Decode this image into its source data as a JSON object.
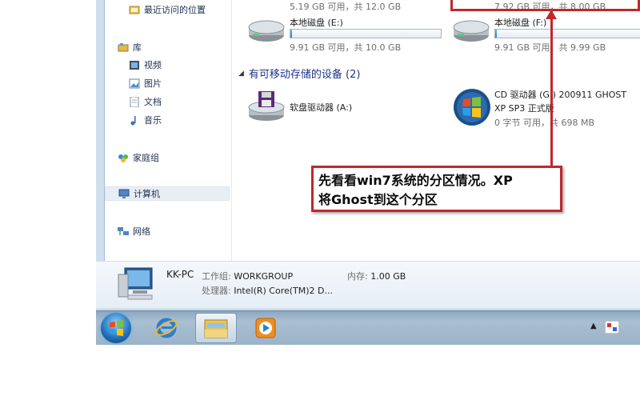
{
  "nav": {
    "recent": "最近访问的位置",
    "library": "库",
    "video": "视频",
    "pictures": "图片",
    "documents": "文档",
    "music": "音乐",
    "homegroup": "家庭组",
    "computer": "计算机",
    "network": "网络"
  },
  "drives": {
    "top_left_info": "5.19 GB 可用，共 12.0 GB",
    "top_right_info": "7.92 GB 可用，共 8.00 GB",
    "e": {
      "name": "本地磁盘 (E:)",
      "info": "9.91 GB 可用，共 10.0 GB",
      "used_fraction": 0.01
    },
    "f": {
      "name": "本地磁盘 (F:)",
      "info": "9.91 GB 可用，共 9.99 GB",
      "used_fraction": 0.01
    }
  },
  "removable": {
    "header": "有可移动存储的设备 (2)",
    "floppy": {
      "name": "软盘驱动器 (A:)"
    },
    "cd": {
      "name_line1": "CD 驱动器 (G:) 200911 GHOST",
      "name_line2": "XP SP3 正式版",
      "info": "0 字节 可用，共 698 MB"
    }
  },
  "details": {
    "pc_name": "KK-PC",
    "workgroup_label": "工作组:",
    "workgroup": "WORKGROUP",
    "memory_label": "内存:",
    "memory": "1.00 GB",
    "cpu_label": "处理器:",
    "cpu": "Intel(R) Core(TM)2 D..."
  },
  "annotation": {
    "line1": "先看看win7系统的分区情况。XP",
    "line2": "将Ghost到这个分区"
  },
  "colors": {
    "annotation_red": "#c0282c",
    "drive_bar": "#2c84d2"
  }
}
